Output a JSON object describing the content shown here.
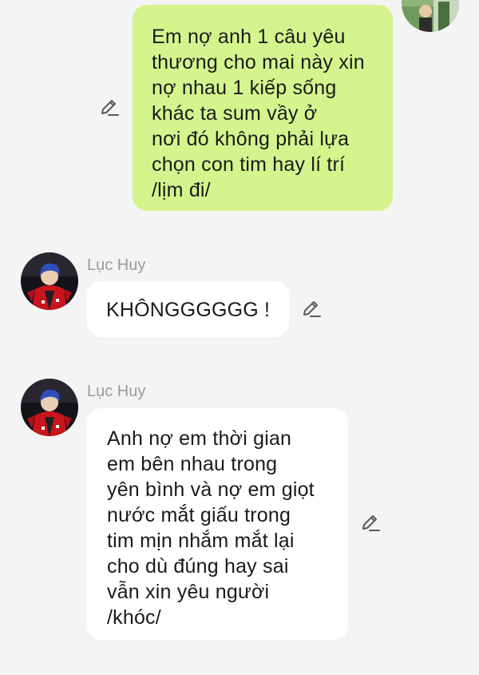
{
  "colors": {
    "page_background": "#f4f4f4",
    "outgoing_bubble": "#d4f58e",
    "incoming_bubble": "#ffffff",
    "sender_name": "#9a9a9a",
    "message_text": "#1a1a1a",
    "edit_icon": "#5a5a5a"
  },
  "messages": [
    {
      "direction": "outgoing",
      "lines": [
        "Em nợ anh 1 câu yêu",
        "thương cho mai này xin",
        "nợ nhau 1 kiếp sống",
        "khác ta sum vầy ở",
        "nơi đó không phải lựa",
        "chọn con tim hay lí trí",
        "/lịm đi/"
      ],
      "icon": "edit-pencil-icon"
    },
    {
      "direction": "incoming",
      "sender": "Lục Huy",
      "lines": [
        "KHÔNGGGGGG !"
      ],
      "icon": "edit-pencil-icon"
    },
    {
      "direction": "incoming",
      "sender": "Lục Huy",
      "lines": [
        "Anh nợ em thời gian",
        "em bên nhau trong",
        "yên bình và nợ em giọt",
        "nước mắt giấu trong",
        "tim mịn nhắm mắt lại",
        "cho dù đúng hay sai",
        "vẫn xin yêu người",
        "/khóc/"
      ],
      "icon": "edit-pencil-icon"
    }
  ]
}
